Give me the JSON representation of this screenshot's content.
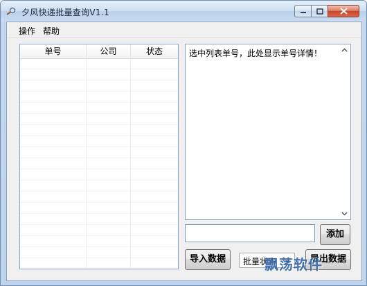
{
  "window": {
    "title": "夕风快递批量查询V1.1"
  },
  "menu": {
    "items": [
      "操作",
      "帮助"
    ]
  },
  "list": {
    "columns": [
      "单号",
      "公司",
      "状态"
    ],
    "rows": []
  },
  "detail": {
    "text": "选中列表单号，此处显示单号详情！"
  },
  "input": {
    "value": "",
    "placeholder": ""
  },
  "buttons": {
    "add": "添加",
    "import": "导入数据",
    "export": "导出数据"
  },
  "status_select": {
    "selected": "批量状态"
  },
  "watermark": "飘荡软件",
  "colors": {
    "accent": "#7ea3d4",
    "close_button": "#c8452a",
    "watermark": "#2e5fa6"
  }
}
